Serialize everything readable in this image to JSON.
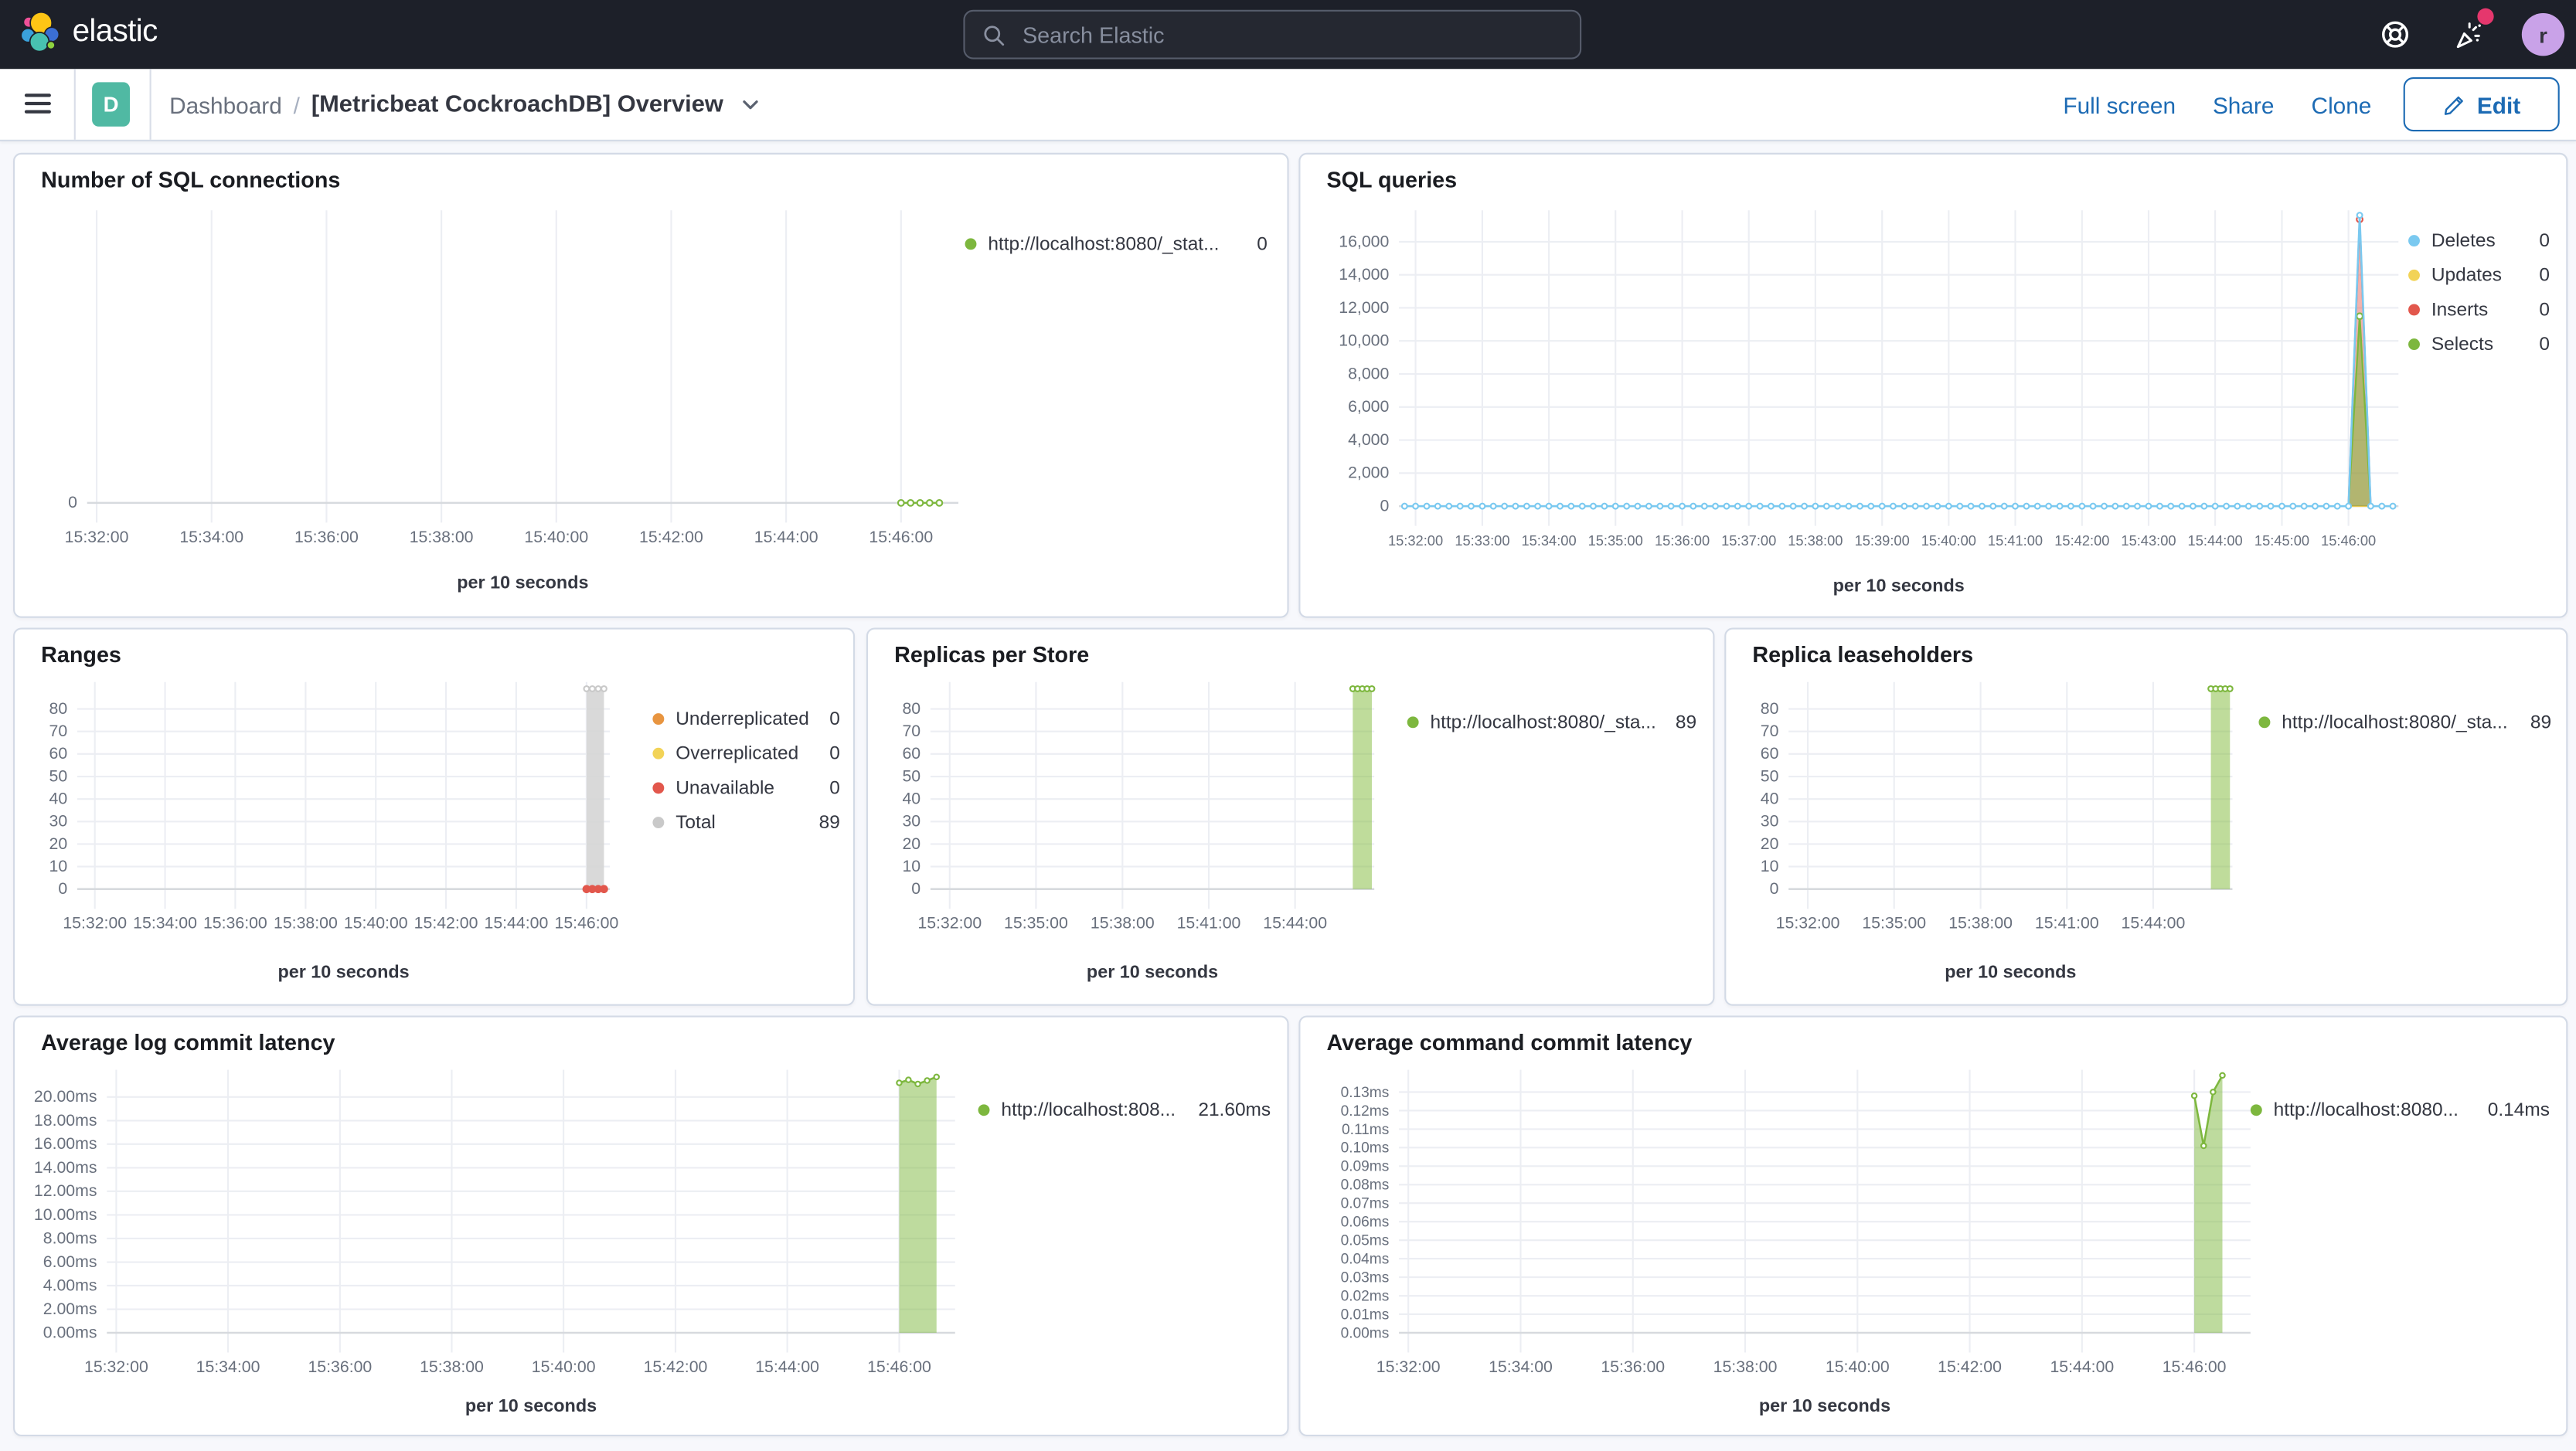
{
  "header": {
    "brand": "elastic",
    "search_placeholder": "Search Elastic",
    "avatar_initial": "r"
  },
  "toolbar": {
    "badge": "D",
    "breadcrumb_root": "Dashboard",
    "breadcrumb_sep": "/",
    "title": "[Metricbeat CockroachDB] Overview",
    "actions": {
      "full_screen": "Full screen",
      "share": "Share",
      "clone": "Clone",
      "edit": "Edit"
    },
    "accent": "#1d6bb4"
  },
  "panels": [
    {
      "title": "Number of SQL connections",
      "legend": [
        {
          "color": "#7db73e",
          "label": "http://localhost:8080/_stat...",
          "value": "0"
        }
      ],
      "chart": {
        "type": "line",
        "x_title": "per 10 seconds",
        "x_range": [
          "15:31:50",
          "15:47:00"
        ],
        "x_ticks": [
          "15:32:00",
          "15:34:00",
          "15:36:00",
          "15:38:00",
          "15:40:00",
          "15:42:00",
          "15:44:00",
          "15:46:00"
        ],
        "y_ticks": [
          {
            "v": 0,
            "label": "0"
          }
        ],
        "ylim": [
          0,
          5
        ],
        "series": [
          {
            "name": "http://localhost:8080/_stat...",
            "color": "#7db73e",
            "markers": true,
            "r": 1.8,
            "lw": 1.2,
            "flat": {
              "from": "15:46:00",
              "to": "15:46:40",
              "step": 10,
              "value": 0
            }
          }
        ]
      }
    },
    {
      "title": "SQL queries",
      "legend": [
        {
          "color": "#7ac9f0",
          "label": "Deletes",
          "value": "0"
        },
        {
          "color": "#f2d357",
          "label": "Updates",
          "value": "0"
        },
        {
          "color": "#e2574c",
          "label": "Inserts",
          "value": "0"
        },
        {
          "color": "#7db73e",
          "label": "Selects",
          "value": "0"
        }
      ],
      "chart": {
        "type": "area",
        "x_title": "per 10 seconds",
        "small_x": true,
        "x_range": [
          "15:31:45",
          "15:46:45"
        ],
        "x_ticks": [
          "15:32:00",
          "15:33:00",
          "15:34:00",
          "15:35:00",
          "15:36:00",
          "15:37:00",
          "15:38:00",
          "15:39:00",
          "15:40:00",
          "15:41:00",
          "15:42:00",
          "15:43:00",
          "15:44:00",
          "15:45:00",
          "15:46:00"
        ],
        "y_ticks": [
          {
            "v": 0,
            "label": "0"
          },
          {
            "v": 2000,
            "label": "2,000"
          },
          {
            "v": 4000,
            "label": "4,000"
          },
          {
            "v": 6000,
            "label": "6,000"
          },
          {
            "v": 8000,
            "label": "8,000"
          },
          {
            "v": 10000,
            "label": "10,000"
          },
          {
            "v": 12000,
            "label": "12,000"
          },
          {
            "v": 14000,
            "label": "14,000"
          },
          {
            "v": 16000,
            "label": "16,000"
          }
        ],
        "ylim": [
          0,
          17900
        ],
        "series": [
          {
            "name": "Updates",
            "color": "#f2d357",
            "lw": 1,
            "flat": {
              "from": "15:31:50",
              "to": "15:46:40",
              "step": 10,
              "value": 0
            }
          },
          {
            "name": "Inserts",
            "color": "#e2574c",
            "fill": "rgba(226,87,76,0.45)",
            "markers": "max",
            "r": 1.8,
            "lw": 1.1,
            "points": [
              [
                "15:46:00",
                0
              ],
              [
                "15:46:10",
                17350
              ],
              [
                "15:46:20",
                0
              ]
            ]
          },
          {
            "name": "Selects",
            "color": "#7db73e",
            "fill": "rgba(125,183,62,0.55)",
            "markers": "max",
            "r": 1.8,
            "lw": 1.1,
            "points": [
              [
                "15:46:00",
                0
              ],
              [
                "15:46:10",
                11500
              ],
              [
                "15:46:20",
                0
              ]
            ]
          },
          {
            "name": "Deletes",
            "color": "#7ac9f0",
            "markers": true,
            "r": 1.6,
            "lw": 1.2,
            "flat": {
              "from": "15:31:50",
              "to": "15:46:40",
              "step": 10,
              "value": 0
            },
            "points": [
              [
                "15:46:10",
                17600
              ]
            ]
          }
        ]
      }
    },
    {
      "title": "Ranges",
      "legend": [
        {
          "color": "#e89540",
          "label": "Underreplicated",
          "value": "0"
        },
        {
          "color": "#f2d357",
          "label": "Overreplicated",
          "value": "0"
        },
        {
          "color": "#e2574c",
          "label": "Unavailable",
          "value": "0"
        },
        {
          "color": "#c9c9c9",
          "label": "Total",
          "value": "89"
        }
      ],
      "chart": {
        "type": "area",
        "x_title": "per 10 seconds",
        "x_range": [
          "15:31:30",
          "15:46:40"
        ],
        "x_ticks": [
          "15:32:00",
          "15:34:00",
          "15:36:00",
          "15:38:00",
          "15:40:00",
          "15:42:00",
          "15:44:00",
          "15:46:00"
        ],
        "y_ticks": [
          {
            "v": 0,
            "label": "0"
          },
          {
            "v": 10,
            "label": "10"
          },
          {
            "v": 20,
            "label": "20"
          },
          {
            "v": 30,
            "label": "30"
          },
          {
            "v": 40,
            "label": "40"
          },
          {
            "v": 50,
            "label": "50"
          },
          {
            "v": 60,
            "label": "60"
          },
          {
            "v": 70,
            "label": "70"
          },
          {
            "v": 80,
            "label": "80"
          }
        ],
        "ylim": [
          0,
          92
        ],
        "series": [
          {
            "name": "Total",
            "color": "#c9c9c9",
            "fill": "rgba(213,213,213,0.9)",
            "markers": true,
            "r": 1.6,
            "lw": 1,
            "flat": {
              "from": "15:46:00",
              "to": "15:46:30",
              "step": 10,
              "value": 89
            }
          },
          {
            "name": "Underreplicated",
            "color": "#e89540",
            "markers": true,
            "solid": true,
            "r": 1.8,
            "lw": 1,
            "flat": {
              "from": "15:46:00",
              "to": "15:46:30",
              "step": 10,
              "value": 0
            }
          },
          {
            "name": "Overreplicated",
            "color": "#f2d357",
            "markers": true,
            "solid": true,
            "r": 1.8,
            "lw": 1,
            "flat": {
              "from": "15:46:00",
              "to": "15:46:30",
              "step": 10,
              "value": 0
            }
          },
          {
            "name": "Unavailable",
            "color": "#e2574c",
            "markers": true,
            "solid": true,
            "r": 2,
            "lw": 1,
            "flat": {
              "from": "15:46:00",
              "to": "15:46:30",
              "step": 10,
              "value": 0
            }
          }
        ]
      }
    },
    {
      "title": "Replicas per Store",
      "legend": [
        {
          "color": "#7db73e",
          "label": "http://localhost:8080/_sta...",
          "value": "89"
        }
      ],
      "chart": {
        "type": "area",
        "x_title": "per 10 seconds",
        "x_range": [
          "15:31:20",
          "15:46:45"
        ],
        "x_ticks": [
          "15:32:00",
          "15:35:00",
          "15:38:00",
          "15:41:00",
          "15:44:00"
        ],
        "y_ticks": [
          {
            "v": 0,
            "label": "0"
          },
          {
            "v": 10,
            "label": "10"
          },
          {
            "v": 20,
            "label": "20"
          },
          {
            "v": 30,
            "label": "30"
          },
          {
            "v": 40,
            "label": "40"
          },
          {
            "v": 50,
            "label": "50"
          },
          {
            "v": 60,
            "label": "60"
          },
          {
            "v": 70,
            "label": "70"
          },
          {
            "v": 80,
            "label": "80"
          }
        ],
        "ylim": [
          0,
          92
        ],
        "series": [
          {
            "name": "http://localhost:8080/_sta...",
            "color": "#7db73e",
            "fill": "rgba(139,191,73,0.55)",
            "markers": true,
            "r": 1.6,
            "lw": 1.1,
            "flat": {
              "from": "15:46:00",
              "to": "15:46:40",
              "step": 10,
              "value": 89
            }
          }
        ]
      }
    },
    {
      "title": "Replica leaseholders",
      "legend": [
        {
          "color": "#7db73e",
          "label": "http://localhost:8080/_sta...",
          "value": "89"
        }
      ],
      "chart": {
        "type": "area",
        "x_title": "per 10 seconds",
        "x_range": [
          "15:31:20",
          "15:46:45"
        ],
        "x_ticks": [
          "15:32:00",
          "15:35:00",
          "15:38:00",
          "15:41:00",
          "15:44:00"
        ],
        "y_ticks": [
          {
            "v": 0,
            "label": "0"
          },
          {
            "v": 10,
            "label": "10"
          },
          {
            "v": 20,
            "label": "20"
          },
          {
            "v": 30,
            "label": "30"
          },
          {
            "v": 40,
            "label": "40"
          },
          {
            "v": 50,
            "label": "50"
          },
          {
            "v": 60,
            "label": "60"
          },
          {
            "v": 70,
            "label": "70"
          },
          {
            "v": 80,
            "label": "80"
          }
        ],
        "ylim": [
          0,
          92
        ],
        "series": [
          {
            "name": "http://localhost:8080/_sta...",
            "color": "#7db73e",
            "fill": "rgba(139,191,73,0.55)",
            "markers": true,
            "r": 1.6,
            "lw": 1.1,
            "flat": {
              "from": "15:46:00",
              "to": "15:46:40",
              "step": 10,
              "value": 89
            }
          }
        ]
      }
    },
    {
      "title": "Average log commit latency",
      "legend": [
        {
          "color": "#7db73e",
          "label": "http://localhost:808...",
          "value": "21.60ms"
        }
      ],
      "chart": {
        "type": "area",
        "x_title": "per 10 seconds",
        "x_range": [
          "15:31:50",
          "15:47:00"
        ],
        "x_ticks": [
          "15:32:00",
          "15:34:00",
          "15:36:00",
          "15:38:00",
          "15:40:00",
          "15:42:00",
          "15:44:00",
          "15:46:00"
        ],
        "y_ticks": [
          {
            "v": 0,
            "label": "0.00ms"
          },
          {
            "v": 2,
            "label": "2.00ms"
          },
          {
            "v": 4,
            "label": "4.00ms"
          },
          {
            "v": 6,
            "label": "6.00ms"
          },
          {
            "v": 8,
            "label": "8.00ms"
          },
          {
            "v": 10,
            "label": "10.00ms"
          },
          {
            "v": 12,
            "label": "12.00ms"
          },
          {
            "v": 14,
            "label": "14.00ms"
          },
          {
            "v": 16,
            "label": "16.00ms"
          },
          {
            "v": 18,
            "label": "18.00ms"
          },
          {
            "v": 20,
            "label": "20.00ms"
          }
        ],
        "ylim": [
          0,
          22.3
        ],
        "series": [
          {
            "name": "http://localhost:808...",
            "color": "#7db73e",
            "fill": "rgba(125,183,62,0.5)",
            "markers": true,
            "r": 1.5,
            "lw": 1.2,
            "points": [
              [
                "15:46:00",
                21.2
              ],
              [
                "15:46:10",
                21.45
              ],
              [
                "15:46:20",
                21.1
              ],
              [
                "15:46:30",
                21.4
              ],
              [
                "15:46:40",
                21.7
              ]
            ]
          }
        ]
      }
    },
    {
      "title": "Average command commit latency",
      "legend": [
        {
          "color": "#7db73e",
          "label": "http://localhost:8080...",
          "value": "0.14ms"
        }
      ],
      "chart": {
        "type": "area",
        "x_title": "per 10 seconds",
        "small_y": true,
        "x_range": [
          "15:31:50",
          "15:47:00"
        ],
        "x_ticks": [
          "15:32:00",
          "15:34:00",
          "15:36:00",
          "15:38:00",
          "15:40:00",
          "15:42:00",
          "15:44:00",
          "15:46:00"
        ],
        "y_ticks": [
          {
            "v": 0,
            "label": "0.00ms"
          },
          {
            "v": 0.01,
            "label": "0.01ms"
          },
          {
            "v": 0.02,
            "label": "0.02ms"
          },
          {
            "v": 0.03,
            "label": "0.03ms"
          },
          {
            "v": 0.04,
            "label": "0.04ms"
          },
          {
            "v": 0.05,
            "label": "0.05ms"
          },
          {
            "v": 0.06,
            "label": "0.06ms"
          },
          {
            "v": 0.07,
            "label": "0.07ms"
          },
          {
            "v": 0.08,
            "label": "0.08ms"
          },
          {
            "v": 0.09,
            "label": "0.09ms"
          },
          {
            "v": 0.1,
            "label": "0.10ms"
          },
          {
            "v": 0.11,
            "label": "0.11ms"
          },
          {
            "v": 0.12,
            "label": "0.12ms"
          },
          {
            "v": 0.13,
            "label": "0.13ms"
          }
        ],
        "ylim": [
          0,
          0.142
        ],
        "series": [
          {
            "name": "http://localhost:8080...",
            "color": "#7db73e",
            "fill": "rgba(125,183,62,0.5)",
            "markers": true,
            "r": 1.5,
            "lw": 1.2,
            "points": [
              [
                "15:46:00",
                0.128
              ],
              [
                "15:46:10",
                0.101
              ],
              [
                "15:46:20",
                0.13
              ],
              [
                "15:46:30",
                0.139
              ]
            ]
          }
        ]
      }
    }
  ]
}
